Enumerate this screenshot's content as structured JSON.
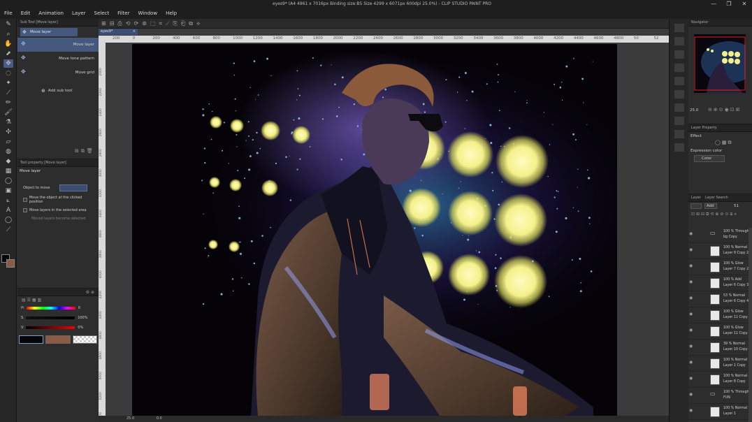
{
  "window": {
    "title": "eyes9* (A4 4961 x 7016px Binding size:B5 Size 4299 x 6071px 600dpi 25.0%) - CLIP STUDIO PAINT PRO",
    "minimize": "—",
    "restore": "❐",
    "close": "✕"
  },
  "menu": [
    "File",
    "Edit",
    "Animation",
    "Layer",
    "Select",
    "Filter",
    "Window",
    "Help"
  ],
  "subtool": {
    "header": "Sub Tool [Move layer]",
    "tab": "Move layer",
    "items": [
      "Move layer",
      "Move tone pattern",
      "Move grid"
    ],
    "add": "Add sub tool"
  },
  "toolprop": {
    "header": "Tool property [Move layer]",
    "title": "Move layer",
    "object_to_move": "Object to move",
    "opt1": "Move the object at the clicked position",
    "opt2": "Move layers in the selected area",
    "opt3": "Moved layers become selected"
  },
  "color": {
    "h_label": "H",
    "h_value": "0",
    "s_label": "S",
    "s_value": "100%",
    "v_label": "V",
    "v_value": "0%",
    "hsv_label": "HSV"
  },
  "canvas": {
    "tab": "eyes9*",
    "ruler_ticks": [
      "200",
      "0",
      "200",
      "400",
      "600",
      "800",
      "1000",
      "1200",
      "1400",
      "1600",
      "1800",
      "2000",
      "2200",
      "2400",
      "2600",
      "2800",
      "3000",
      "3200",
      "3400",
      "3600",
      "3800",
      "4000",
      "4200",
      "4400",
      "4600",
      "4800",
      "50",
      "52"
    ],
    "ruler_left_ticks": [
      "2000",
      "2200",
      "2400",
      "2600",
      "2800",
      "3000",
      "3200",
      "3400",
      "3600",
      "3800",
      "4000",
      "4200",
      "4400",
      "4600",
      "4800",
      "5000",
      "5200",
      "5400"
    ],
    "zoom": "25.0",
    "angle": "0.0"
  },
  "navigator": {
    "header": "Navigator",
    "zoom": "25.0"
  },
  "layerprop": {
    "header": "Layer Property",
    "effect": "Effect",
    "expression_color": "Expression color",
    "color_value": "Color"
  },
  "layers": {
    "tab1": "Layer",
    "tab2": "Layer Search",
    "tab3": "Layer",
    "blend": "Add",
    "opacity": "51",
    "rows": [
      {
        "l1": "100 % Through",
        "l2": "bg Copy",
        "folder": true
      },
      {
        "l1": "100 % Normal",
        "l2": "Layer 9 Copy 2",
        "folder": false
      },
      {
        "l1": "100 % Glow",
        "l2": "Layer 7 Copy 2",
        "folder": false
      },
      {
        "l1": "100 % Add",
        "l2": "Layer 6 Copy 3",
        "folder": false
      },
      {
        "l1": "53 % Normal",
        "l2": "Layer 6 Copy 4",
        "folder": false
      },
      {
        "l1": "100 % Glow",
        "l2": "Layer 11 Copy",
        "folder": false
      },
      {
        "l1": "100 % Glow",
        "l2": "Layer 11 Copy",
        "folder": false
      },
      {
        "l1": "39 % Normal",
        "l2": "Layer 10 Copy",
        "folder": false
      },
      {
        "l1": "100 % Normal",
        "l2": "Layer 1 Copy",
        "folder": false
      },
      {
        "l1": "100 % Normal",
        "l2": "Layer 8 Copy",
        "folder": false
      },
      {
        "l1": "100 % Through",
        "l2": "FUN",
        "folder": true
      },
      {
        "l1": "100 % Normal",
        "l2": "Layer 1",
        "folder": false
      }
    ]
  },
  "colors": {
    "accent": "#45597f",
    "panel": "#2d2d2d",
    "bokeh": "#f4f08a"
  }
}
